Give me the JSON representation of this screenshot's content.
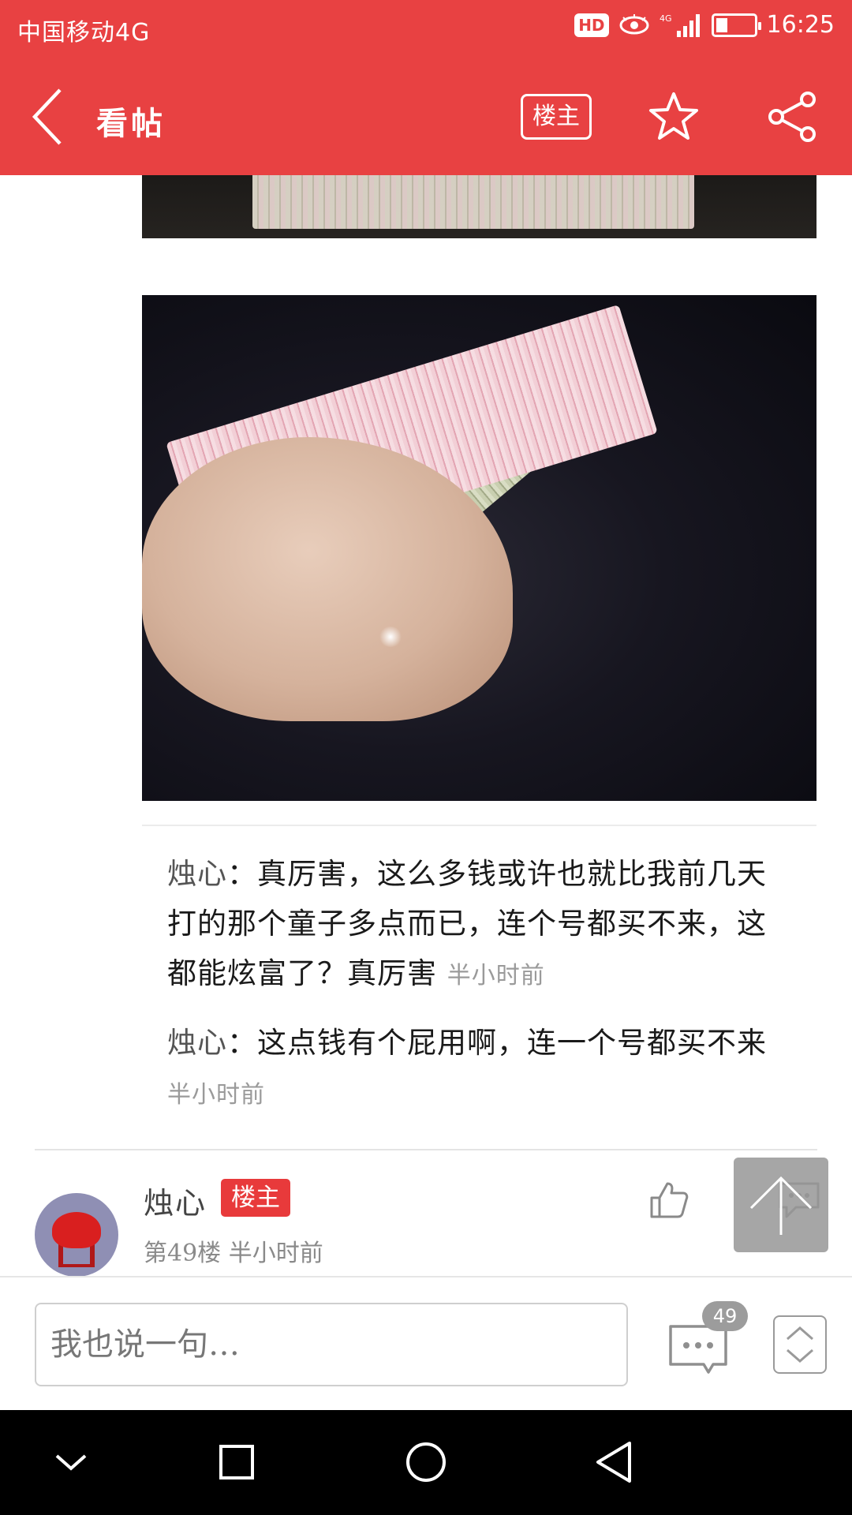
{
  "status_bar": {
    "carrier": "中国移动4G",
    "hd_badge": "HD",
    "signal_label": "4G",
    "time": "16:25"
  },
  "app_bar": {
    "title": "看帖",
    "author_only_label": "楼主",
    "icons": [
      "back-arrow-icon",
      "star-icon",
      "share-icon"
    ]
  },
  "sub_replies": [
    {
      "name": "烛心",
      "separator": "：",
      "text": "真厉害，这么多钱或许也就比我前几天打的那个童子多点而已，连个号都买不来，这都能炫富了？真厉害",
      "time": "半小时前"
    },
    {
      "name": "烛心",
      "separator": "：",
      "text": "这点钱有个屁用啊，连一个号都买不来",
      "time": "半小时前"
    }
  ],
  "next_floor": {
    "user_name": "烛心",
    "badge": "楼主",
    "floor": "第49楼",
    "time": "半小时前"
  },
  "input_bar": {
    "placeholder": "我也说一句…",
    "comment_count": "49"
  },
  "colors": {
    "brand_red": "#e84142",
    "badge_red": "#e83a3b",
    "timestamp_gray": "#9a9a9a"
  }
}
